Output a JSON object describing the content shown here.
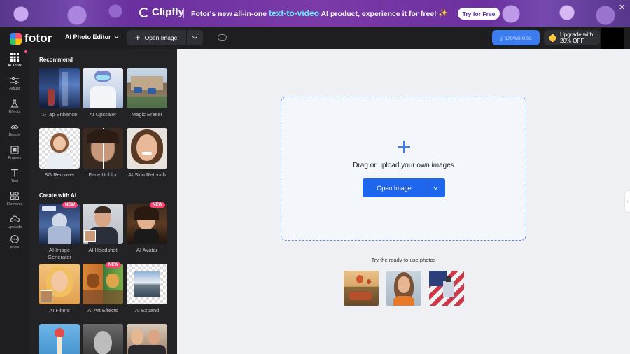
{
  "banner": {
    "brand": "Clipfly",
    "promo_prefix": "Fotor's new all-in-one ",
    "promo_highlight": "text-to-video",
    "promo_suffix": " AI product, experience it for free!",
    "try_label": "Try for Free"
  },
  "topbar": {
    "brand": "fotor",
    "editor_menu": "AI Photo Editor",
    "open_image": "Open Image",
    "download": "Download",
    "upgrade_line1": "Upgrade with",
    "upgrade_line2": "20% OFF"
  },
  "rail": {
    "items": [
      {
        "label": "AI Tools",
        "icon": "grid-icon",
        "active": true
      },
      {
        "label": "Adjust",
        "icon": "sliders-icon"
      },
      {
        "label": "Effects",
        "icon": "flask-icon"
      },
      {
        "label": "Beauty",
        "icon": "eye-icon"
      },
      {
        "label": "Frames",
        "icon": "frame-icon"
      },
      {
        "label": "Text",
        "icon": "text-icon"
      },
      {
        "label": "Elements",
        "icon": "shapes-icon"
      },
      {
        "label": "Uploads",
        "icon": "cloud-upload-icon"
      },
      {
        "label": "More",
        "icon": "more-icon"
      }
    ]
  },
  "panel": {
    "recommend_title": "Recommend",
    "create_title": "Create with AI",
    "new_badge": "NEW",
    "recommend": [
      {
        "name": "1-Tap Enhance"
      },
      {
        "name": "AI Upscaler"
      },
      {
        "name": "Magic Eraser"
      },
      {
        "name": "BG Remover"
      },
      {
        "name": "Face Unblur"
      },
      {
        "name": "AI Skin Retouch"
      }
    ],
    "create": [
      {
        "name": "AI Image Generator",
        "new": true
      },
      {
        "name": "AI Headshot",
        "new": false
      },
      {
        "name": "AI Avatar",
        "new": true
      },
      {
        "name": "AI Filters",
        "new": false
      },
      {
        "name": "AI Art Effects",
        "new": true
      },
      {
        "name": "AI Expand",
        "new": false
      }
    ]
  },
  "canvas": {
    "drop_text": "Drag or upload your own images",
    "open_button": "Open Image",
    "try_text": "Try the ready-to-use photos"
  },
  "colors": {
    "accent": "#1f66ef",
    "dark_bg": "#1e1e21",
    "panel_bg": "#232326",
    "new_badge": "#ff3d6e"
  }
}
